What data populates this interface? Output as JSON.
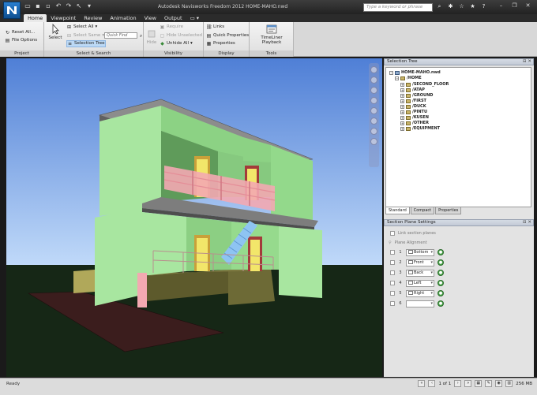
{
  "titlebar": {
    "window_title": "Autodesk Navisworks Freedom 2012  HOME-MAHO.nwd",
    "search_placeholder": "Type a keyword or phrase"
  },
  "ribbon_tabs": [
    "Home",
    "Viewpoint",
    "Review",
    "Animation",
    "View",
    "Output"
  ],
  "ribbon": {
    "project": {
      "label": "Project",
      "reset_all": "Reset All...",
      "file_options": "File Options"
    },
    "select_search": {
      "label": "Select & Search",
      "select": "Select",
      "select_all": "Select All",
      "select_same": "Select Same",
      "quick_find_placeholder": "Quick Find",
      "selection_tree": "Selection Tree"
    },
    "visibility": {
      "label": "Visibility",
      "hide": "Hide",
      "require": "Require",
      "hide_unselected": "Hide Unselected",
      "unhide_all": "Unhide All"
    },
    "display": {
      "label": "Display",
      "links": "Links",
      "quick_properties": "Quick Properties",
      "properties": "Properties"
    },
    "tools": {
      "label": "Tools",
      "timeliner": "TimeLiner Playback"
    }
  },
  "selection_tree": {
    "title": "Selection Tree",
    "root": "HOME-MAHO.nwd",
    "home": "/HOME",
    "layers": [
      "/SECOND_FLOOR",
      "/ATAP",
      "/GROUND",
      "/FIRST",
      "/DUCK",
      "/PINTU",
      "/KUSEN",
      "/OTHER",
      "/EQUIPMENT"
    ],
    "tabs": [
      "Standard",
      "Compact",
      "Properties"
    ]
  },
  "section_plane": {
    "title": "Section Plane Settings",
    "link_label": "Link section planes",
    "alignment_label": "Plane Alignment",
    "planes": [
      {
        "num": "1",
        "alignment": "Bottom"
      },
      {
        "num": "2",
        "alignment": "Front"
      },
      {
        "num": "3",
        "alignment": "Back"
      },
      {
        "num": "4",
        "alignment": "Left"
      },
      {
        "num": "5",
        "alignment": "Right"
      },
      {
        "num": "6",
        "alignment": ""
      }
    ]
  },
  "statusbar": {
    "text": "Ready",
    "page": "1 of 1",
    "size": "256 MB"
  },
  "colors": {
    "sky_top": "#4f7fd6",
    "sky_bottom": "#c3dcfa",
    "ground": "#162716",
    "wall_green": "#a8e6a0",
    "railing_pink": "#f3a9b1",
    "roof_gray": "#8c8c8c"
  }
}
